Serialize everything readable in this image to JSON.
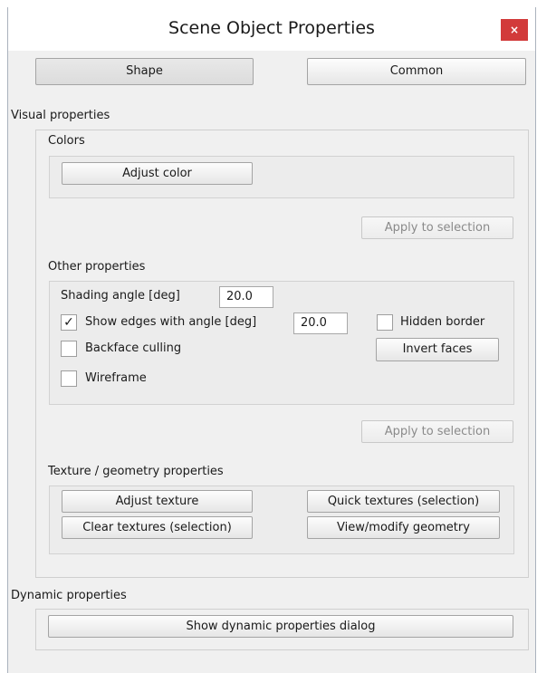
{
  "window": {
    "title": "Scene Object Properties",
    "close_glyph": "×"
  },
  "tabs": [
    {
      "label": "Shape",
      "active": true
    },
    {
      "label": "Common",
      "active": false
    }
  ],
  "visual": {
    "heading": "Visual properties",
    "colors": {
      "heading": "Colors",
      "adjust_color": "Adjust color",
      "apply": "Apply to selection"
    },
    "other": {
      "heading": "Other properties",
      "shading_label": "Shading angle [deg]",
      "shading_value": "20.0",
      "show_edges_label": "Show edges with angle [deg]",
      "show_edges_checked": true,
      "show_edges_value": "20.0",
      "checkmark": "✓",
      "hidden_border_label": "Hidden border",
      "hidden_border_checked": false,
      "backface_label": "Backface culling",
      "backface_checked": false,
      "wireframe_label": "Wireframe",
      "wireframe_checked": false,
      "invert_faces": "Invert faces",
      "apply": "Apply to selection"
    },
    "texture": {
      "heading": "Texture / geometry properties",
      "adjust_texture": "Adjust texture",
      "quick_textures": "Quick textures (selection)",
      "clear_textures": "Clear textures (selection)",
      "view_geometry": "View/modify geometry"
    }
  },
  "dynamic": {
    "heading": "Dynamic properties",
    "show_dialog": "Show dynamic properties dialog"
  }
}
